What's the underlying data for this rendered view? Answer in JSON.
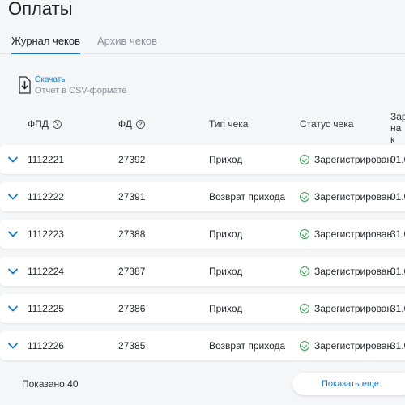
{
  "page": {
    "title": "Оплаты"
  },
  "tabs": [
    {
      "label": "Журнал чеков",
      "active": true
    },
    {
      "label": "Архив чеков",
      "active": false
    }
  ],
  "download": {
    "link": "Скачать",
    "subtitle": "Отчет в CSV-формате",
    "icon": "download-file-icon"
  },
  "table": {
    "headers": {
      "fpd": "ФПД",
      "fd": "ФД",
      "type": "Тип чека",
      "status": "Статус чека",
      "reg_line1": "Зар",
      "reg_line2": "на к"
    },
    "rows": [
      {
        "fpd": "1112221",
        "fd": "27392",
        "type": "Приход",
        "status": "Зарегистрирован",
        "date": "01.0"
      },
      {
        "fpd": "1112222",
        "fd": "27391",
        "type": "Возврат прихода",
        "status": "Зарегистрирован",
        "date": "01.0"
      },
      {
        "fpd": "1112223",
        "fd": "27388",
        "type": "Приход",
        "status": "Зарегистрирован",
        "date": "31.0"
      },
      {
        "fpd": "1112224",
        "fd": "27387",
        "type": "Приход",
        "status": "Зарегистрирован",
        "date": "31.0"
      },
      {
        "fpd": "1112225",
        "fd": "27386",
        "type": "Приход",
        "status": "Зарегистрирован",
        "date": "31.0"
      },
      {
        "fpd": "1112226",
        "fd": "27385",
        "type": "Возврат прихода",
        "status": "Зарегистрирован",
        "date": "31.0"
      }
    ]
  },
  "footer": {
    "shown": "Показано 40",
    "more_button": "Показать еще"
  },
  "colors": {
    "accent": "#1677cc",
    "success": "#2e9f4a",
    "background": "#f5f6f8"
  }
}
